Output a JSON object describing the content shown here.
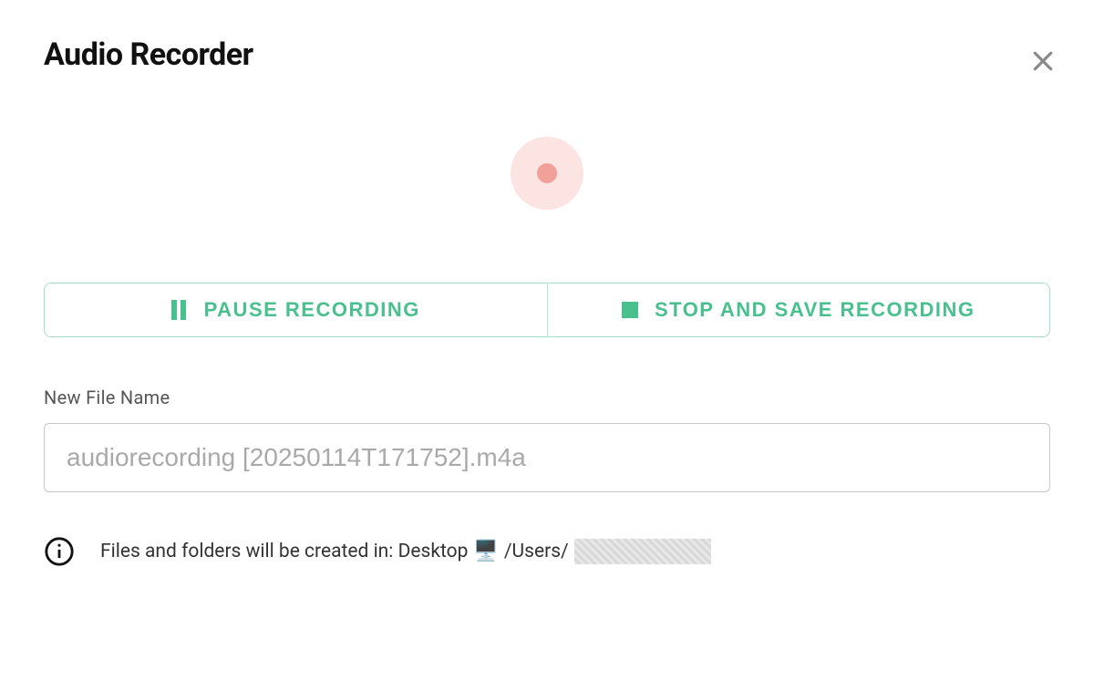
{
  "dialog": {
    "title": "Audio Recorder"
  },
  "controls": {
    "pause_label": "PAUSE RECORDING",
    "stop_label": "STOP AND SAVE RECORDING"
  },
  "file": {
    "label": "New File Name",
    "value": "audiorecording [20250114T171752].m4a"
  },
  "info": {
    "prefix": "Files and folders will be created in: Desktop",
    "path": "/Users/"
  }
}
